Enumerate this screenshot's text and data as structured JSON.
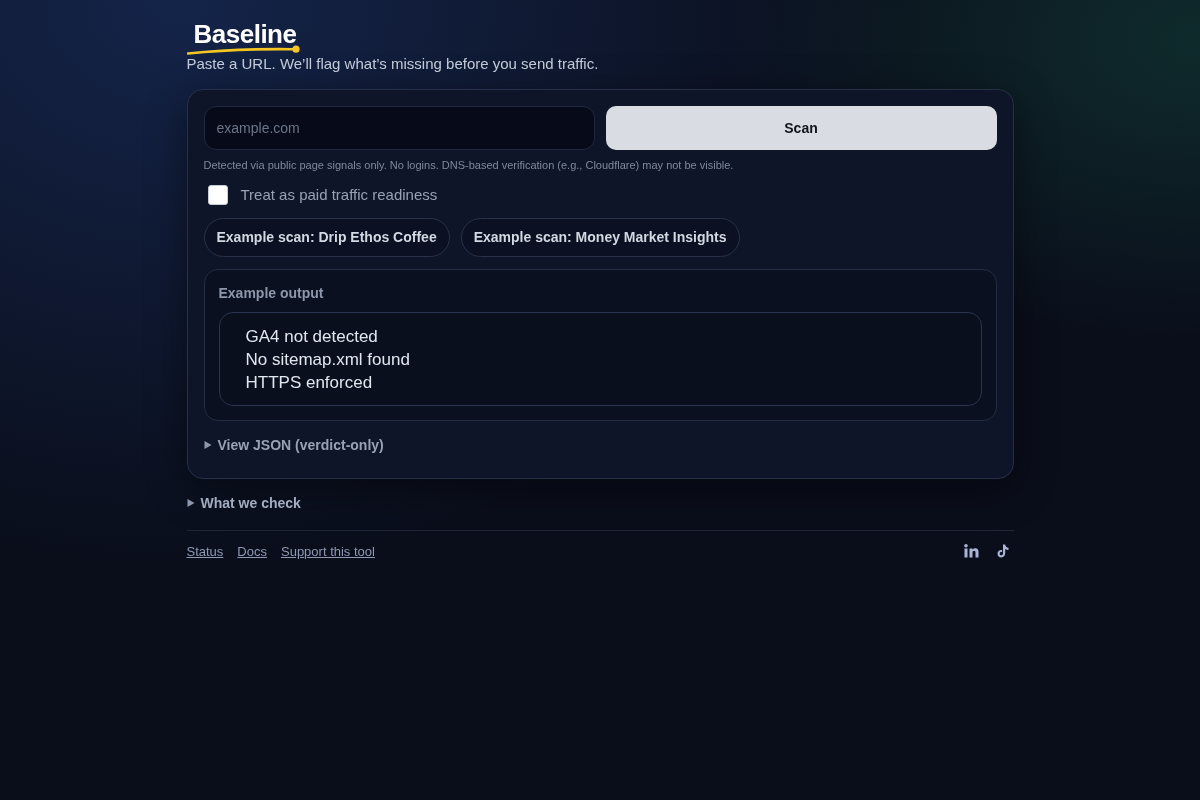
{
  "brand": {
    "name": "Baseline"
  },
  "tagline": "Paste a URL. We’ll flag what’s missing before you send traffic.",
  "scan_form": {
    "url_field": {
      "placeholder": "example.com"
    },
    "scan_button": "Scan",
    "hint": "Detected via public page signals only. No logins. DNS-based verification (e.g., Cloudflare) may not be visible.",
    "paid_traffic_option": {
      "label": "Treat as paid traffic readiness",
      "checked": false
    },
    "example_scans": [
      "Example scan: Drip Ethos Coffee",
      "Example scan: Money Market Insights"
    ],
    "example_output": {
      "title": "Example output",
      "lines": [
        "GA4 not detected",
        "No sitemap.xml found",
        "HTTPS enforced"
      ]
    },
    "view_json": {
      "label": "View JSON (verdict-only)",
      "expanded": false
    }
  },
  "what_we_check": {
    "label": "What we check",
    "expanded": false
  },
  "footer": {
    "links": [
      "Status",
      "Docs",
      "Support this tool"
    ]
  }
}
